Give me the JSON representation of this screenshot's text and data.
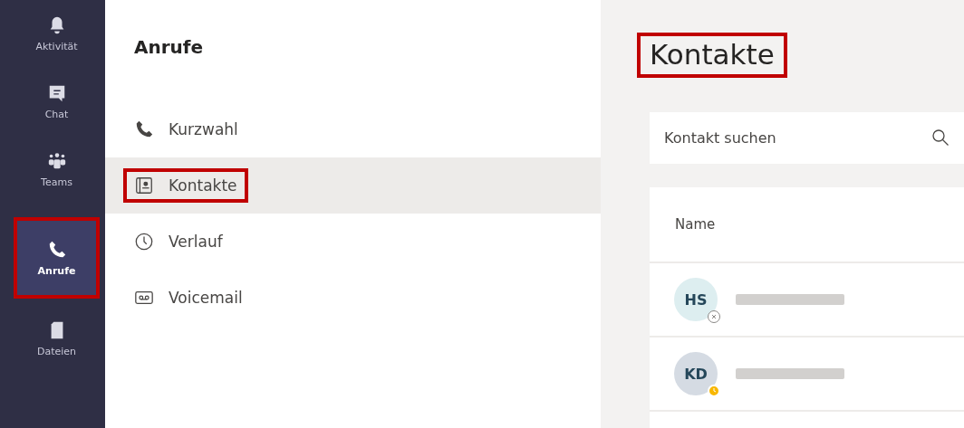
{
  "rail": [
    {
      "label": "Aktivität",
      "kind": "bell",
      "selected": false,
      "highlighted": false
    },
    {
      "label": "Chat",
      "kind": "chat",
      "selected": false,
      "highlighted": false
    },
    {
      "label": "Teams",
      "kind": "teams",
      "selected": false,
      "highlighted": false
    },
    {
      "label": "Anrufe",
      "kind": "phone",
      "selected": true,
      "highlighted": true
    },
    {
      "label": "Dateien",
      "kind": "file",
      "selected": false,
      "highlighted": false
    }
  ],
  "sidebar": {
    "title": "Anrufe",
    "items": [
      {
        "label": "Kurzwahl",
        "kind": "phone",
        "selected": false,
        "highlighted": false
      },
      {
        "label": "Kontakte",
        "kind": "contact",
        "selected": true,
        "highlighted": true
      },
      {
        "label": "Verlauf",
        "kind": "clock",
        "selected": false,
        "highlighted": false
      },
      {
        "label": "Voicemail",
        "kind": "voicemail",
        "selected": false,
        "highlighted": false
      }
    ]
  },
  "main": {
    "title": "Kontakte",
    "title_highlighted": true,
    "search": {
      "placeholder": "Kontakt suchen"
    },
    "table": {
      "columns": [
        "Name"
      ],
      "rows": [
        {
          "initials": "HS",
          "kind": "offline",
          "color": "#ddeef0"
        },
        {
          "initials": "KD",
          "kind": "away",
          "color": "#d5dbe3"
        }
      ]
    }
  }
}
